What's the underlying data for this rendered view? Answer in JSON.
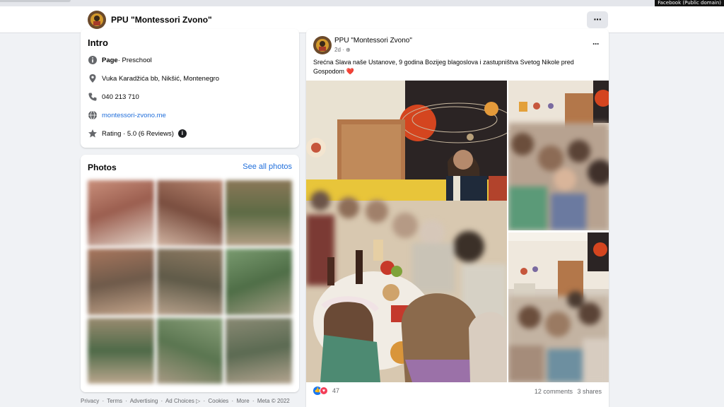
{
  "credit": "Facebook (Public domain)",
  "page": {
    "name": "PPU \"Montessori Zvono\""
  },
  "intro": {
    "title": "Intro",
    "category_label": "Page",
    "category_value": " · Preschool",
    "address": "Vuka Karadžića bb, Nikšić, Montenegro",
    "phone": "040 213 710",
    "website": "montessori-zvono.me",
    "rating": "Rating · 5.0 (6 Reviews)",
    "icons": [
      "info-icon",
      "location-pin-icon",
      "phone-icon",
      "globe-icon",
      "star-icon",
      "info-dot-icon"
    ]
  },
  "photos": {
    "title": "Photos",
    "see_all": "See all photos",
    "thumb_colors": [
      "#b06a5a",
      "#a4735f",
      "#8d7a5c",
      "#9a6a55",
      "#7e6e5c",
      "#6f8b63",
      "#5f7a4c",
      "#6b8654",
      "#7a7b66"
    ]
  },
  "footer": {
    "links": [
      "Privacy",
      "·",
      "Terms",
      "·",
      "Advertising",
      "·",
      "Ad Choices ▷",
      "·",
      "Cookies",
      "·",
      "More",
      "·",
      "Meta © 2022"
    ]
  },
  "post": {
    "author": "PPU \"Montessori Zvono\"",
    "time": "2d · ⊕",
    "text": "Srećna Slava naše Ustanove, 9 godina Bozijeg blagoslova i zastupništva Svetog Nikole pred Gospodom",
    "heart": "❤️",
    "reaction_count": "47",
    "comments": "12 comments",
    "shares": "3 shares",
    "reaction_icons": [
      "like-icon",
      "love-icon"
    ]
  },
  "colors": {
    "accent": "#216fdb",
    "background": "#f0f2f5",
    "card": "#ffffff"
  }
}
